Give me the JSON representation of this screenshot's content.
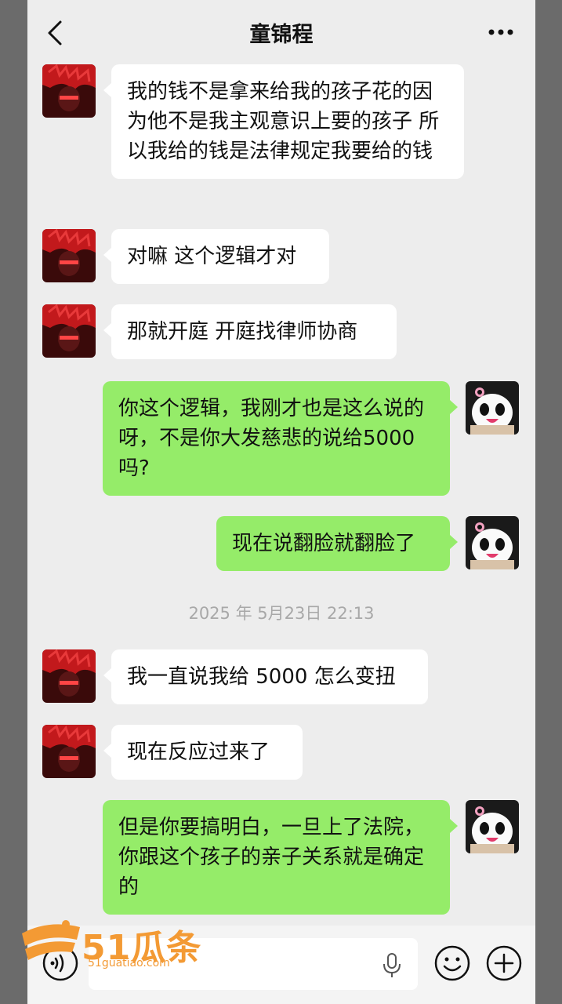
{
  "header": {
    "title": "童锦程"
  },
  "messages": [
    {
      "side": "in",
      "text": "我的钱不是拿来给我的孩子花的因为他不是我主观意识上要的孩子 所以我给的钱是法律规定我要给的钱"
    },
    {
      "side": "in",
      "text": "对嘛 这个逻辑才对"
    },
    {
      "side": "in",
      "text": "那就开庭 开庭找律师协商"
    },
    {
      "side": "out",
      "text": "你这个逻辑，我刚才也是这么说的呀，不是你大发慈悲的说给5000吗?"
    },
    {
      "side": "out",
      "text": "现在说翻脸就翻脸了"
    },
    {
      "side": "in",
      "text": "我一直说我给 5000 怎么变扭"
    },
    {
      "side": "in",
      "text": "现在反应过来了"
    },
    {
      "side": "out",
      "text": "但是你要搞明白，一旦上了法院，你跟这个孩子的亲子关系就是确定的"
    }
  ],
  "timestamp": "2025 年 5月23日 22:13",
  "watermark": {
    "brand": "51瓜条",
    "url": "51guatiao.com"
  },
  "colors": {
    "incoming_bubble": "#ffffff",
    "outgoing_bubble": "#95ec69",
    "background": "#ededed"
  },
  "icons": {
    "back": "chevron-left-icon",
    "more": "more-dots-icon",
    "voice": "voice-icon",
    "mic": "microphone-icon",
    "emoji": "emoji-icon",
    "plus": "plus-icon"
  }
}
